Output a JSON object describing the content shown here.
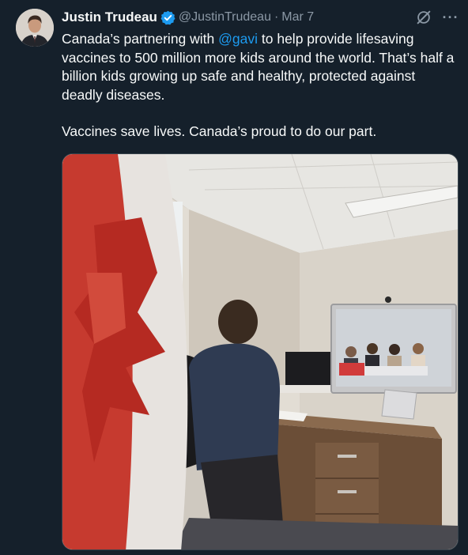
{
  "tweet": {
    "author": {
      "display_name": "Justin Trudeau",
      "handle": "@JustinTrudeau",
      "verified": true,
      "avatar_icon": "profile-photo"
    },
    "separator": "·",
    "date": "Mar 7",
    "actions": {
      "grok_icon": "grok-icon",
      "more_icon": "more-options-icon",
      "more_glyph": "···"
    },
    "text": {
      "p1_before": "Canada’s partnering with ",
      "p1_mention": "@gavi",
      "p1_after": " to help provide lifesaving vaccines to 500 million more kids around the world. That’s half a billion kids growing up safe and healthy, protected against deadly diseases.",
      "p2": "Vaccines save lives. Canada’s proud to do our part."
    },
    "media": {
      "type": "photo"
    }
  },
  "colors": {
    "background": "#15202b",
    "text_primary": "#f7f9f9",
    "text_secondary": "#8b98a5",
    "link": "#1d9bf0",
    "verified_badge": "#1d9bf0"
  }
}
